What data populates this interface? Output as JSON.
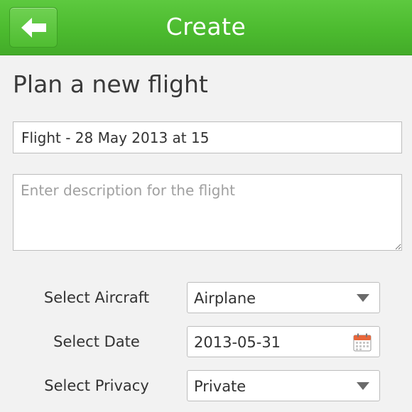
{
  "header": {
    "title": "Create",
    "back_icon": "back-arrow-icon",
    "accent_color": "#4cbb2f"
  },
  "page": {
    "heading": "Plan a new flight"
  },
  "form": {
    "flight_name_value": "Flight - 28 May 2013 at 15",
    "description_placeholder": "Enter description for the flight",
    "aircraft": {
      "label": "Select Aircraft",
      "value": "Airplane",
      "icon": "chevron-down-icon"
    },
    "date": {
      "label": "Select Date",
      "value": "2013-05-31",
      "icon": "calendar-icon"
    },
    "privacy": {
      "label": "Select Privacy",
      "value": "Private",
      "icon": "chevron-down-icon"
    }
  }
}
